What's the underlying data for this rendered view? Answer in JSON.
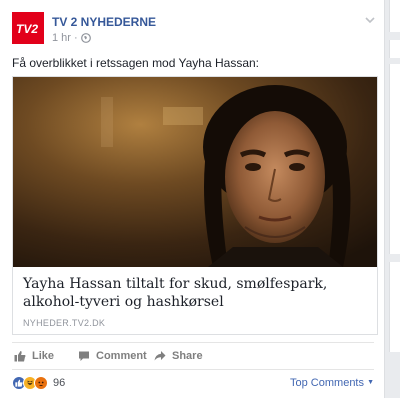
{
  "post": {
    "page_name": "TV 2 NYHEDERNE",
    "time": "1 hr",
    "caption": "Få overblikket i retssagen mod Yayha Hassan:",
    "logo_text": "TV2"
  },
  "link": {
    "title": "Yayha Hassan tiltalt for skud, smølfespark, alkohol-tyveri og hashkørsel",
    "domain": "NYHEDER.TV2.DK"
  },
  "actions": {
    "like": "Like",
    "comment": "Comment",
    "share": "Share"
  },
  "footer": {
    "reaction_count": "96",
    "top_comments": "Top Comments"
  },
  "colors": {
    "brand": "#e2001a",
    "link_blue": "#365899",
    "muted": "#90949c"
  }
}
